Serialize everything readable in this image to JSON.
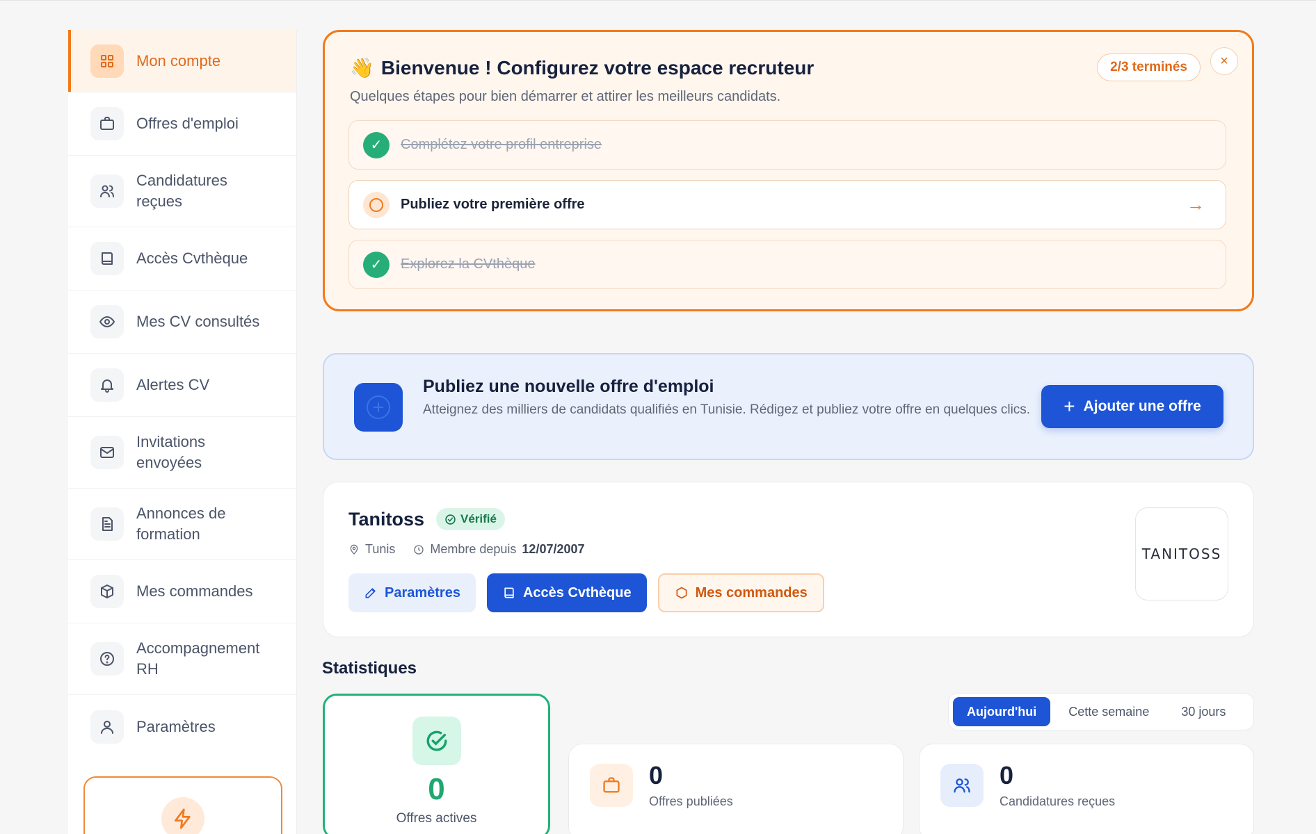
{
  "sidebar": {
    "items": [
      {
        "label": "Mon compte",
        "icon": "grid-icon"
      },
      {
        "label": "Offres d'emploi",
        "icon": "briefcase-icon"
      },
      {
        "label": "Candidatures reçues",
        "icon": "users-icon"
      },
      {
        "label": "Accès Cvthèque",
        "icon": "book-icon"
      },
      {
        "label": "Mes CV consultés",
        "icon": "eye-icon"
      },
      {
        "label": "Alertes CV",
        "icon": "bell-icon"
      },
      {
        "label": "Invitations envoyées",
        "icon": "mail-icon"
      },
      {
        "label": "Annonces de formation",
        "icon": "document-icon"
      },
      {
        "label": "Mes commandes",
        "icon": "package-icon"
      },
      {
        "label": "Accompagnement RH",
        "icon": "help-circle-icon"
      },
      {
        "label": "Paramètres",
        "icon": "user-icon"
      }
    ]
  },
  "onboarding": {
    "emoji": "👋",
    "title": "Bienvenue ! Configurez votre espace recruteur",
    "subtitle": "Quelques étapes pour bien démarrer et attirer les meilleurs candidats.",
    "progress": "2/3 terminés",
    "close": "×",
    "steps": [
      {
        "label": "Complétez votre profil entreprise",
        "done": true
      },
      {
        "label": "Publiez votre première offre",
        "done": false,
        "arrow": "→"
      },
      {
        "label": "Explorez la CVthèque",
        "done": true
      }
    ],
    "check": "✓"
  },
  "publish": {
    "title": "Publiez une nouvelle offre d'emploi",
    "description": "Atteignez des milliers de candidats qualifiés en Tunisie. Rédigez et publiez votre offre en quelques clics.",
    "button_plus": "+",
    "button_label": "Ajouter une offre"
  },
  "company": {
    "name": "Tanitoss",
    "verified": "Vérifié",
    "location": "Tunis",
    "member_since_label": "Membre depuis",
    "member_since_date": "12/07/2007",
    "actions": {
      "settings": "Paramètres",
      "cvtheque": "Accès Cvthèque",
      "orders": "Mes commandes"
    },
    "logo_text": "TANITOSS"
  },
  "stats": {
    "title": "Statistiques",
    "ranges": [
      "Aujourd'hui",
      "Cette semaine",
      "30 jours"
    ],
    "selected_range": "Aujourd'hui",
    "active_offers": {
      "value": "0",
      "label": "Offres actives"
    },
    "published_offers": {
      "value": "0",
      "label": "Offres publiées"
    },
    "applications": {
      "value": "0",
      "label": "Candidatures reçues"
    }
  },
  "colors": {
    "accent_orange": "#f27a1a",
    "primary_blue": "#1d55d6",
    "success_green": "#22b27a"
  }
}
